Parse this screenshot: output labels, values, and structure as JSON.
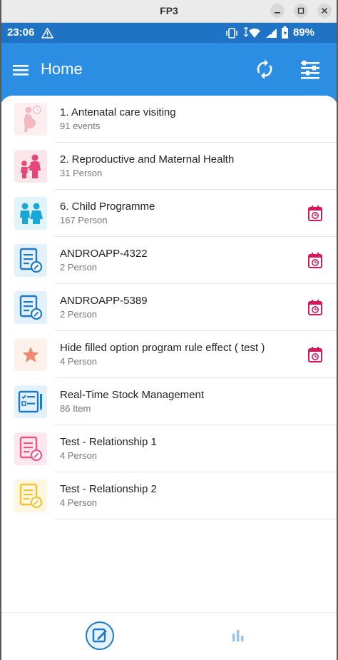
{
  "window": {
    "title": "FP3"
  },
  "status_bar": {
    "time": "23:06",
    "battery": "89%"
  },
  "app_bar": {
    "title": "Home"
  },
  "colors": {
    "primary": "#2c8ee3",
    "status_bar": "#1f72c4",
    "calendar_icon": "#d8175a"
  },
  "programs": [
    {
      "name": "1. Antenatal care visiting",
      "count": "91 events",
      "icon": "pregnant-woman-icon",
      "has_calendar": false
    },
    {
      "name": "2. Reproductive and Maternal Health",
      "count": "31 Person",
      "icon": "mother-child-icon",
      "has_calendar": false
    },
    {
      "name": "6. Child Programme",
      "count": "167 Person",
      "icon": "children-icon",
      "has_calendar": true
    },
    {
      "name": "ANDROAPP-4322",
      "count": "2 Person",
      "icon": "form-icon",
      "has_calendar": true
    },
    {
      "name": "ANDROAPP-5389",
      "count": "2 Person",
      "icon": "form-icon",
      "has_calendar": true
    },
    {
      "name": "Hide filled option program rule effect ( test )",
      "count": "4 Person",
      "icon": "star-icon",
      "has_calendar": true
    },
    {
      "name": "Real-Time Stock Management",
      "count": "86 Item",
      "icon": "checklist-icon",
      "has_calendar": false
    },
    {
      "name": "Test - Relationship 1",
      "count": "4 Person",
      "icon": "form-icon",
      "has_calendar": false
    },
    {
      "name": "Test - Relationship 2",
      "count": "4 Person",
      "icon": "form-icon",
      "has_calendar": false
    }
  ],
  "bottom_nav": [
    {
      "name": "programs",
      "icon": "edit-form-icon",
      "active": true
    },
    {
      "name": "analytics",
      "icon": "bar-chart-icon",
      "active": false
    }
  ]
}
